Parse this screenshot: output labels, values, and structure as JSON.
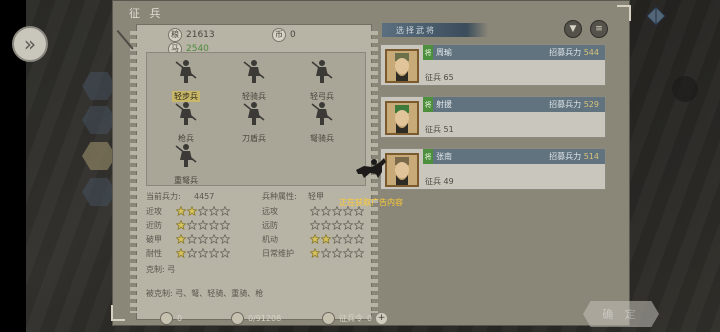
{
  "window": {
    "title": "征 兵"
  },
  "resources": {
    "food": "21613",
    "horses": "2540",
    "gold_top": "0"
  },
  "units": [
    {
      "label": "轻步兵",
      "selected": true
    },
    {
      "label": "轻骑兵",
      "selected": false
    },
    {
      "label": "轻弓兵",
      "selected": false
    },
    {
      "label": "枪兵",
      "selected": false
    },
    {
      "label": "刀盾兵",
      "selected": false
    },
    {
      "label": "弩骑兵",
      "selected": false
    },
    {
      "label": "重弩兵",
      "selected": false
    }
  ],
  "stats": {
    "current_troops_label": "当前兵力:",
    "current_troops_value": "4457",
    "attribute_label": "兵种属性:",
    "attribute_value": "轻甲",
    "left": [
      {
        "label": "近攻",
        "stars": 2
      },
      {
        "label": "近防",
        "stars": 1
      },
      {
        "label": "破甲",
        "stars": 1
      },
      {
        "label": "耐性",
        "stars": 1
      }
    ],
    "right": [
      {
        "label": "远攻",
        "stars": 0
      },
      {
        "label": "远防",
        "stars": 0
      },
      {
        "label": "机动",
        "stars": 2
      },
      {
        "label": "日常维护",
        "stars": 1
      }
    ],
    "counters_label": "克制:",
    "counters_value": "弓",
    "countered_label": "被克制:",
    "countered_value": "弓、弩、轻骑、重骑、枪"
  },
  "generals_header": "选择武将",
  "generals": [
    {
      "tag": "将",
      "name": "周瑜",
      "recruit_label": "招募兵力",
      "recruit_value": "544",
      "soldiers": "征兵 65"
    },
    {
      "tag": "将",
      "name": "射援",
      "recruit_label": "招募兵力",
      "recruit_value": "529",
      "soldiers": "征兵 51"
    },
    {
      "tag": "将",
      "name": "张南",
      "recruit_label": "招募兵力",
      "recruit_value": "514",
      "soldiers": "征兵 49"
    }
  ],
  "ad_loading": "正在获取广告内容",
  "bottom": {
    "gold": "0",
    "capacity": "0/91208",
    "order_label": "征兵令",
    "order_value": "0"
  },
  "confirm_label": "确 定",
  "colors": {
    "accent_gold": "#c7b766",
    "recruit_value": "#d8c37a",
    "ad_text": "#ffcc33",
    "tag_green": "#4c8f3c"
  }
}
